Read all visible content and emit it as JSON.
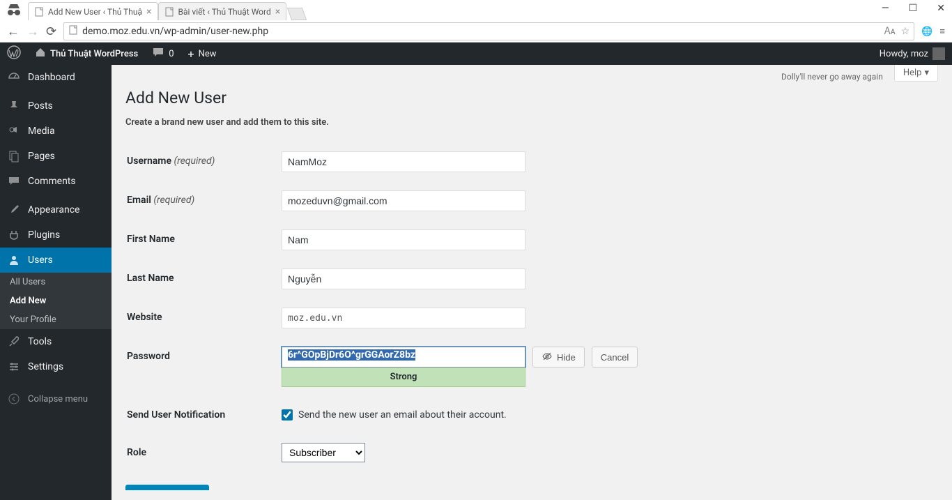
{
  "browser": {
    "tabs": [
      {
        "title": "Add New User ‹ Thủ Thuậ",
        "active": true
      },
      {
        "title": "Bài viết ‹ Thủ Thuật Word",
        "active": false
      }
    ],
    "url": "demo.moz.edu.vn/wp-admin/user-new.php"
  },
  "adminbar": {
    "site_name": "Thủ Thuật WordPress",
    "comments_count": "0",
    "new_label": "New",
    "howdy": "Howdy, moz"
  },
  "menu": {
    "dashboard": "Dashboard",
    "posts": "Posts",
    "media": "Media",
    "pages": "Pages",
    "comments": "Comments",
    "appearance": "Appearance",
    "plugins": "Plugins",
    "users": "Users",
    "tools": "Tools",
    "settings": "Settings",
    "collapse": "Collapse menu",
    "sub_users": {
      "all": "All Users",
      "add": "Add New",
      "profile": "Your Profile"
    }
  },
  "screen": {
    "dolly": "Dolly'll never go away again",
    "help": "Help"
  },
  "page": {
    "title": "Add New User",
    "subtitle": "Create a brand new user and add them to this site."
  },
  "form": {
    "username_label": "Username",
    "required": "(required)",
    "username_value": "NamMoz",
    "email_label": "Email",
    "email_value": "mozeduvn@gmail.com",
    "firstname_label": "First Name",
    "firstname_value": "Nam",
    "lastname_label": "Last Name",
    "lastname_value": "Nguyễn",
    "website_label": "Website",
    "website_value": "moz.edu.vn",
    "password_label": "Password",
    "password_value": "6r^GOpBjDr6O^grGGAorZ8bz",
    "password_strength": "Strong",
    "hide_btn": "Hide",
    "cancel_btn": "Cancel",
    "notification_label": "Send User Notification",
    "notification_text": "Send the new user an email about their account.",
    "role_label": "Role",
    "role_value": "Subscriber"
  }
}
